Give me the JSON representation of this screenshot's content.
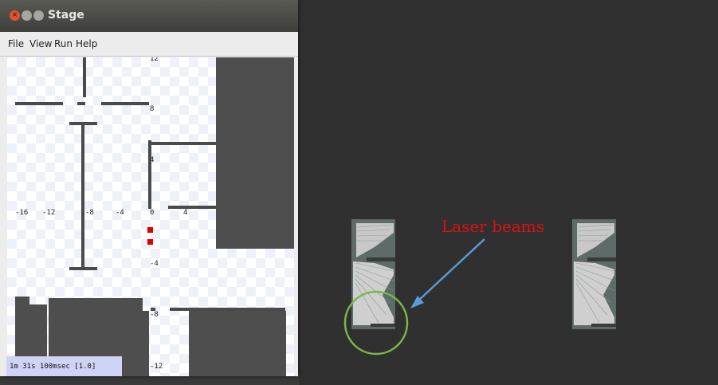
{
  "window": {
    "title": "Stage",
    "buttons": [
      "close",
      "minimize",
      "maximize"
    ]
  },
  "menu": {
    "file": "File",
    "view": "View",
    "run": "Run",
    "help": "Help"
  },
  "map": {
    "x_ticks": [
      "-16",
      "-12",
      "-8",
      "-4",
      "0",
      "4"
    ],
    "y_ticks": [
      "12",
      "8",
      "4",
      "-4",
      "-8",
      "-12"
    ],
    "robot_color": "#e00000"
  },
  "status": {
    "text": "1m 31s 100msec [1.0]"
  },
  "annotation": {
    "label": "Laser beams",
    "label_color": "#e01010",
    "arrow_color": "#5a9ad8",
    "circle_color": "#7ab648"
  }
}
